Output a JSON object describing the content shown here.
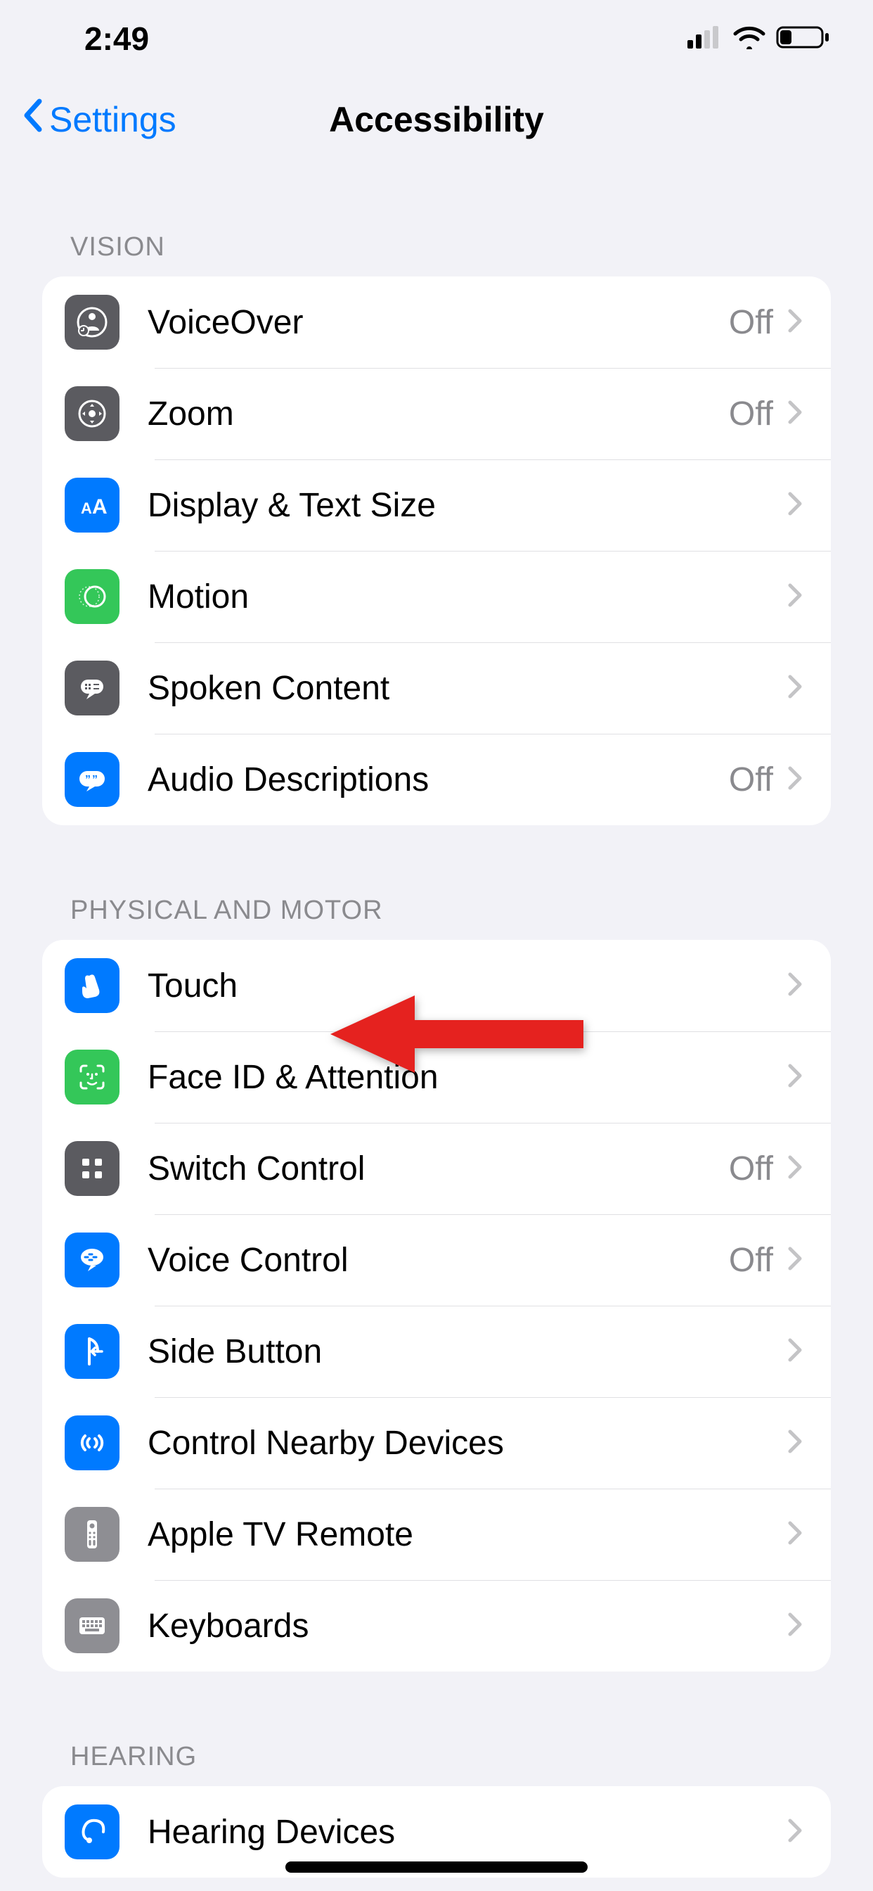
{
  "status_bar": {
    "time": "2:49"
  },
  "nav": {
    "back_label": "Settings",
    "title": "Accessibility"
  },
  "sections": {
    "vision": {
      "header": "VISION",
      "voiceover": {
        "label": "VoiceOver",
        "detail": "Off"
      },
      "zoom": {
        "label": "Zoom",
        "detail": "Off"
      },
      "display_text_size": {
        "label": "Display & Text Size",
        "detail": ""
      },
      "motion": {
        "label": "Motion",
        "detail": ""
      },
      "spoken_content": {
        "label": "Spoken Content",
        "detail": ""
      },
      "audio_descriptions": {
        "label": "Audio Descriptions",
        "detail": "Off"
      }
    },
    "physical": {
      "header": "PHYSICAL AND MOTOR",
      "touch": {
        "label": "Touch",
        "detail": ""
      },
      "face_id": {
        "label": "Face ID & Attention",
        "detail": ""
      },
      "switch_control": {
        "label": "Switch Control",
        "detail": "Off"
      },
      "voice_control": {
        "label": "Voice Control",
        "detail": "Off"
      },
      "side_button": {
        "label": "Side Button",
        "detail": ""
      },
      "control_nearby": {
        "label": "Control Nearby Devices",
        "detail": ""
      },
      "apple_tv_remote": {
        "label": "Apple TV Remote",
        "detail": ""
      },
      "keyboards": {
        "label": "Keyboards",
        "detail": ""
      }
    },
    "hearing": {
      "header": "HEARING",
      "hearing_devices": {
        "label": "Hearing Devices",
        "detail": ""
      }
    }
  }
}
